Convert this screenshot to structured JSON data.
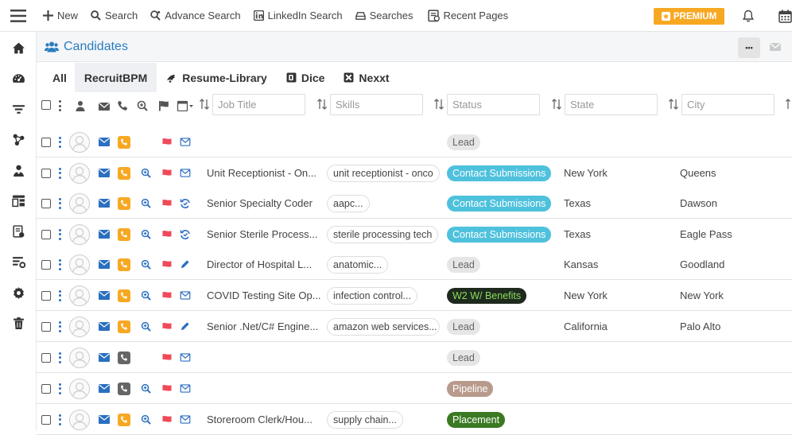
{
  "topnav": {
    "items": [
      {
        "label": "New",
        "icon": "plus-icon"
      },
      {
        "label": "Search",
        "icon": "search-icon"
      },
      {
        "label": "Advance Search",
        "icon": "advance-search-icon"
      },
      {
        "label": "LinkedIn Search",
        "icon": "linkedin-icon"
      },
      {
        "label": "Searches",
        "icon": "searches-icon"
      },
      {
        "label": "Recent Pages",
        "icon": "recent-pages-icon"
      }
    ],
    "premium_label": "PREMIUM"
  },
  "sidebar": {
    "items": [
      "home-icon",
      "dashboard-icon",
      "filter-icon",
      "network-icon",
      "users-icon",
      "layout-icon",
      "reports-icon",
      "settings-list-icon",
      "gear-icon",
      "trash-icon"
    ]
  },
  "header": {
    "title": "Candidates",
    "more_label": "•••"
  },
  "tabs": [
    {
      "label": "All",
      "icon": ""
    },
    {
      "label": "RecruitBPM",
      "icon": ""
    },
    {
      "label": "Resume-Library",
      "icon": "resume-library-icon"
    },
    {
      "label": "Dice",
      "icon": "dice-icon"
    },
    {
      "label": "Nexxt",
      "icon": "nexxt-icon"
    }
  ],
  "filters": {
    "job_title": "Job Title",
    "skills": "Skills",
    "status": "Status",
    "state": "State",
    "city": "City"
  },
  "colors": {
    "accent": "#2a7dc0",
    "phone_orange": "#f7a823",
    "phone_gray": "#666666",
    "flag_red": "#f04a5a",
    "lead_bg": "#e6e6e6",
    "contact_bg": "#4ec1dd",
    "w2_bg": "#1e2a1e",
    "pipeline_bg": "#b89a8c",
    "placement_bg": "#3a7a22"
  },
  "rows": [
    {
      "phone": "orange",
      "zoom": false,
      "action": "mail",
      "job_title": "",
      "skill": "",
      "status": "Lead",
      "status_type": "lead",
      "state": "",
      "city": ""
    },
    {
      "phone": "orange",
      "zoom": true,
      "action": "mail",
      "job_title": "Unit Receptionist - On...",
      "skill": "unit receptionist - onco",
      "status": "Contact Submissions",
      "status_type": "contact",
      "state": "New York",
      "city": "Queens"
    },
    {
      "phone": "orange",
      "zoom": true,
      "action": "sync",
      "job_title": "Senior Specialty Coder",
      "skill": "aapc...",
      "status": "Contact Submissions",
      "status_type": "contact",
      "state": "Texas",
      "city": "Dawson"
    },
    {
      "phone": "orange",
      "zoom": true,
      "action": "sync",
      "job_title": "Senior Sterile Process...",
      "skill": "sterile processing tech",
      "status": "Contact Submissions",
      "status_type": "contact",
      "state": "Texas",
      "city": "Eagle Pass"
    },
    {
      "phone": "orange",
      "zoom": true,
      "action": "edit",
      "job_title": "Director of Hospital L...",
      "skill": "anatomic...",
      "status": "Lead",
      "status_type": "lead",
      "state": "Kansas",
      "city": "Goodland"
    },
    {
      "phone": "orange",
      "zoom": true,
      "action": "mail",
      "job_title": "COVID Testing Site Op...",
      "skill": "infection control...",
      "status": "W2 W/ Benefits",
      "status_type": "w2",
      "state": "New York",
      "city": "New York"
    },
    {
      "phone": "orange",
      "zoom": true,
      "action": "edit",
      "job_title": "Senior .Net/C# Engine...",
      "skill": "amazon web services...",
      "status": "Lead",
      "status_type": "lead",
      "state": "California",
      "city": "Palo Alto"
    },
    {
      "phone": "gray",
      "zoom": false,
      "action": "mail",
      "job_title": "",
      "skill": "",
      "status": "Lead",
      "status_type": "lead",
      "state": "",
      "city": ""
    },
    {
      "phone": "gray",
      "zoom": true,
      "action": "mail",
      "job_title": "",
      "skill": "",
      "status": "Pipeline",
      "status_type": "pipeline",
      "state": "",
      "city": ""
    },
    {
      "phone": "orange",
      "zoom": true,
      "action": "mail",
      "job_title": "Storeroom Clerk/Hou...",
      "skill": "supply chain...",
      "status": "Placement",
      "status_type": "placement",
      "state": "",
      "city": ""
    }
  ]
}
